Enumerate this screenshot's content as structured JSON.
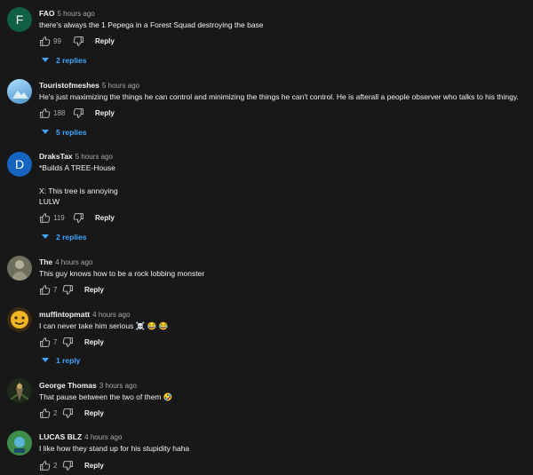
{
  "comments": [
    {
      "author": "FAO",
      "time": "5 hours ago",
      "lines": [
        "there's always the 1 Pepega in a Forest Squad destroying the base"
      ],
      "likes": "99",
      "reply_label": "Reply",
      "replies": "2 replies",
      "avatar_letter": "F",
      "avatar_color": "#0f5f47"
    },
    {
      "author": "Touristofmeshes",
      "time": "5 hours ago",
      "lines": [
        "He's just maximizing the things he can control and minimizing the things he can't control. He is afterall a people observer who talks to his thingy."
      ],
      "likes": "188",
      "reply_label": "Reply",
      "replies": "5 replies",
      "avatar_icon": "blue-sky-avatar"
    },
    {
      "author": "DraksTax",
      "time": "5 hours ago",
      "lines": [
        "*Builds A TREE-House",
        "",
        "X: This tree is annoying",
        "LULW"
      ],
      "likes": "119",
      "reply_label": "Reply",
      "replies": "2 replies",
      "avatar_letter": "D",
      "avatar_color": "#1565c0"
    },
    {
      "author": "The",
      "time": "4 hours ago",
      "lines": [
        "This guy knows how to be a rock lobbing monster"
      ],
      "likes": "7",
      "reply_label": "Reply",
      "avatar_icon": "grey-figure-avatar"
    },
    {
      "author": "muffintopmatt",
      "time": "4 hours ago",
      "lines": [
        "I can never take him serious ☠️ 😂 😂"
      ],
      "likes": "7",
      "reply_label": "Reply",
      "replies": "1 reply",
      "avatar_icon": "yellow-face-avatar"
    },
    {
      "author": "George Thomas",
      "time": "3 hours ago",
      "lines": [
        "That pause between the two of them 🤣"
      ],
      "likes": "2",
      "reply_label": "Reply",
      "avatar_icon": "dark-character-avatar"
    },
    {
      "author": "LUCAS BLZ",
      "time": "4 hours ago",
      "lines": [
        "I like how they stand up for his stupidity haha"
      ],
      "likes": "2",
      "reply_label": "Reply",
      "avatar_icon": "green-blue-avatar"
    }
  ]
}
